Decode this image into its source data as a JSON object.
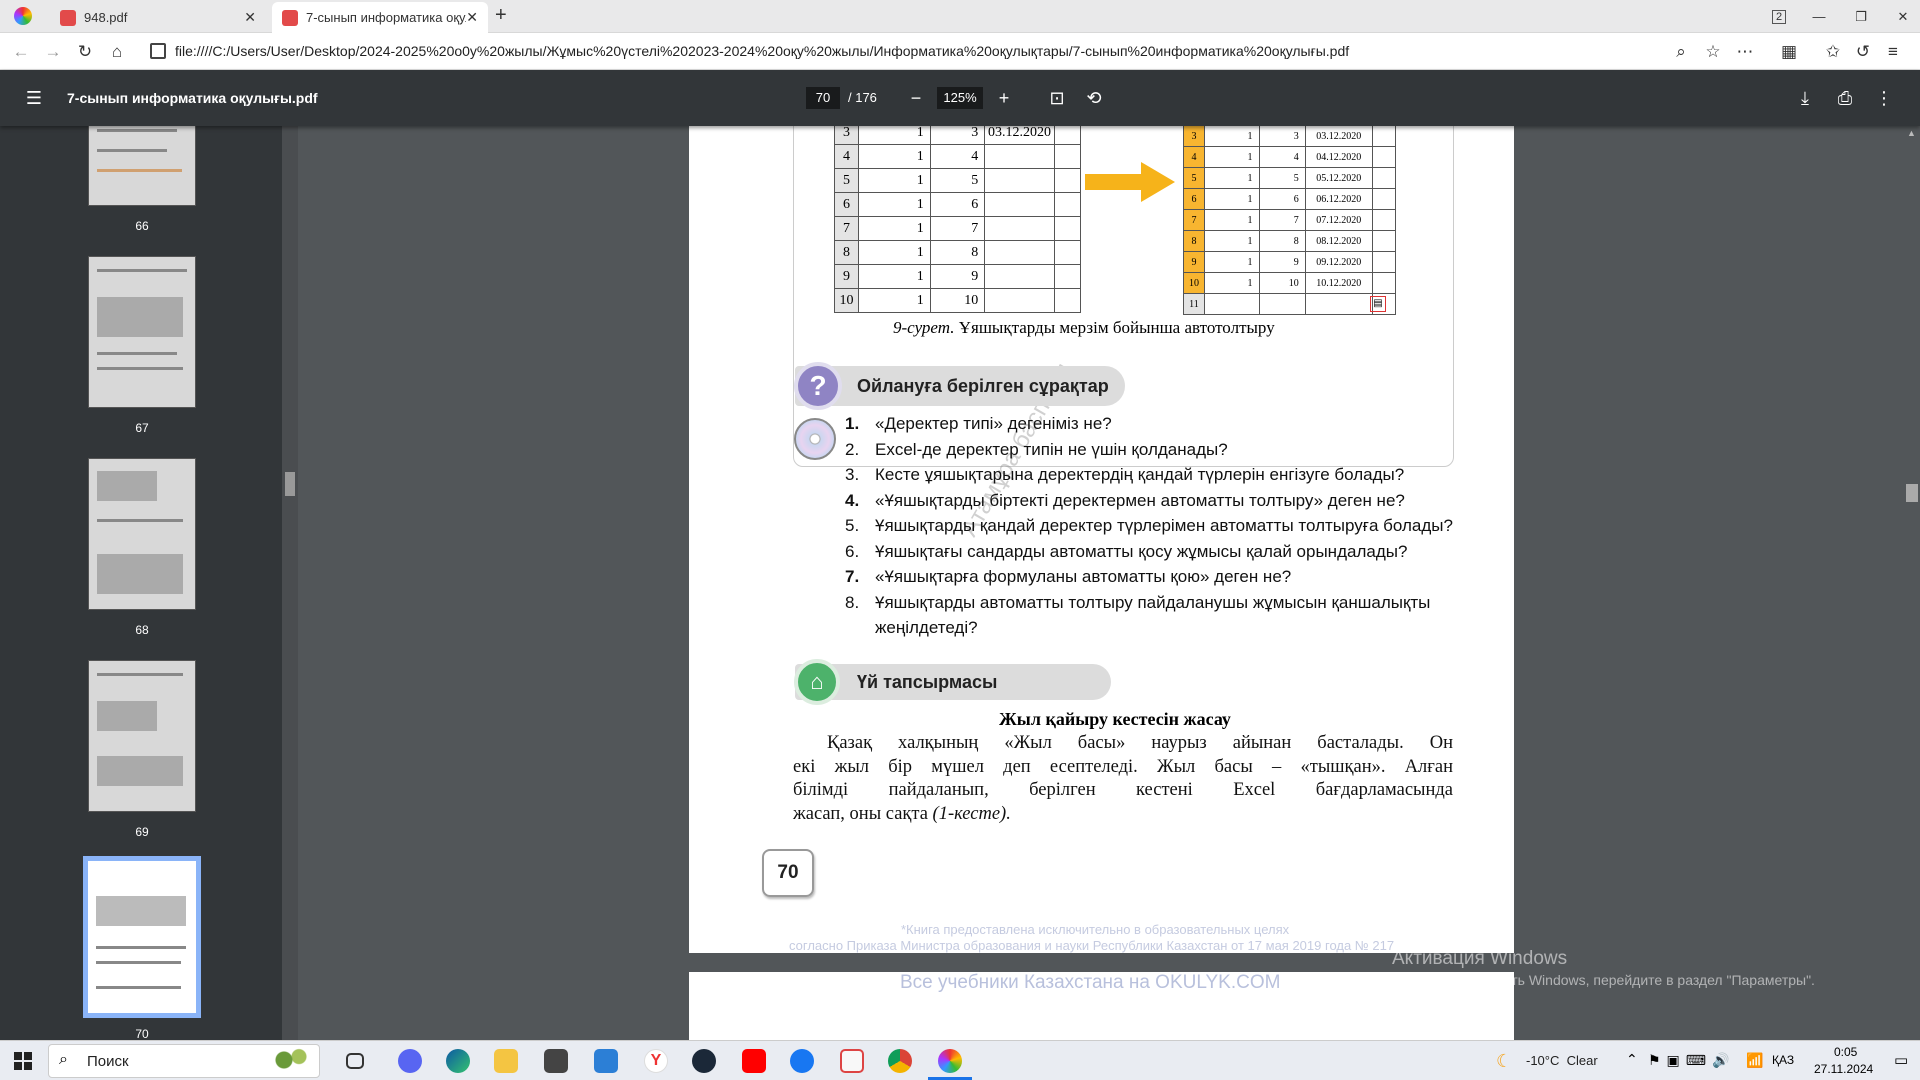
{
  "browser": {
    "tabs": [
      {
        "label": "948.pdf"
      },
      {
        "label": "7-сынып информатика оқул"
      }
    ],
    "url": "file:////C:/Users/User/Desktop/2024-2025%20о0у%20жылы/Жұмыс%20үстелі%202023-2024%20оқу%20жылы/Информатика%20оқулықтары/7-сынып%20информатика%20оқулығы.pdf",
    "tab_count": "2"
  },
  "pdf": {
    "title": "7-сынып информатика оқулығы.pdf",
    "page_current": "70",
    "page_total": "/ 176",
    "zoom": "125%"
  },
  "thumbnails": [
    {
      "label": "66"
    },
    {
      "label": "67"
    },
    {
      "label": "68"
    },
    {
      "label": "69"
    },
    {
      "label": "70"
    }
  ],
  "content": {
    "left_table": [
      [
        "3",
        "1",
        "3",
        "03.12.2020"
      ],
      [
        "4",
        "1",
        "4",
        ""
      ],
      [
        "5",
        "1",
        "5",
        ""
      ],
      [
        "6",
        "1",
        "6",
        ""
      ],
      [
        "7",
        "1",
        "7",
        ""
      ],
      [
        "8",
        "1",
        "8",
        ""
      ],
      [
        "9",
        "1",
        "9",
        ""
      ],
      [
        "10",
        "1",
        "10",
        ""
      ]
    ],
    "right_table": [
      [
        "3",
        "1",
        "3",
        "03.12.2020"
      ],
      [
        "4",
        "1",
        "4",
        "04.12.2020"
      ],
      [
        "5",
        "1",
        "5",
        "05.12.2020"
      ],
      [
        "6",
        "1",
        "6",
        "06.12.2020"
      ],
      [
        "7",
        "1",
        "7",
        "07.12.2020"
      ],
      [
        "8",
        "1",
        "8",
        "08.12.2020"
      ],
      [
        "9",
        "1",
        "9",
        "09.12.2020"
      ],
      [
        "10",
        "1",
        "10",
        "10.12.2020"
      ],
      [
        "11",
        "",
        "",
        ""
      ]
    ],
    "figure_caption_italic": "9-сурет.",
    "figure_caption": " Ұяшықтарды мерзім бойынша автотолтыру",
    "questions_heading": "Ойлануға берілген сұрақтар",
    "questions": [
      {
        "n": "1.",
        "t": "«Деректер типі» дегеніміз не?"
      },
      {
        "n": "2.",
        "t": "Excel-де деректер типін не үшін қолданады?"
      },
      {
        "n": "3.",
        "t": "Кесте ұяшықтарына деректердің қандай түрлерін енгізуге болады?"
      },
      {
        "n": "4.",
        "t": "«Ұяшықтарды біртекті деректермен автоматты толтыру» деген не?"
      },
      {
        "n": "5.",
        "t": "Ұяшықтарды қандай деректер түрлерімен автоматты толтыруға болады?"
      },
      {
        "n": "6.",
        "t": "Ұяшықтағы сандарды автоматты қосу жұмысы қалай орындалады?"
      },
      {
        "n": "7.",
        "t": "«Ұяшықтарға формуланы автоматты қою» деген не?"
      },
      {
        "n": "8.",
        "t": "Ұяшықтарды автоматты толтыру пайдаланушы жұмысын қаншалықты"
      },
      {
        "n": "",
        "t": "жеңілдетеді?"
      }
    ],
    "homework_heading": "Үй тапсырмасы",
    "homework_title": "Жыл қайыру кестесін жасау",
    "homework_lines": [
      "Қазақ халқының «Жыл басы» наурыз айынан басталады. Он",
      "екі жыл бір мүшел деп есептеледі. Жыл басы – «тышқан». Алған",
      "білімді пайдаланып, берілген кестені Excel бағдарламасында"
    ],
    "homework_last": "жасап, оны сақта ",
    "homework_last_italic": "(1-кесте).",
    "page_number": "70",
    "footer1": "*Книга предоставлена исключительно в образовательных целях",
    "footer2": "согласно Приказа Министра образования и науки Республики Казахстан от 17 мая 2019 года № 217",
    "footer3": "Все учебники Казахстана на OKULYK.COM",
    "watermark": "Атамұра баспасы"
  },
  "windows_activation": {
    "title": "Активация Windows",
    "subtitle": "Чтобы активировать Windows, перейдите в раздел \"Параметры\"."
  },
  "taskbar": {
    "search": "Поиск",
    "weather": "-10°C  Clear",
    "lang": "ҚАЗ",
    "time": "0:05",
    "date": "27.11.2024"
  }
}
